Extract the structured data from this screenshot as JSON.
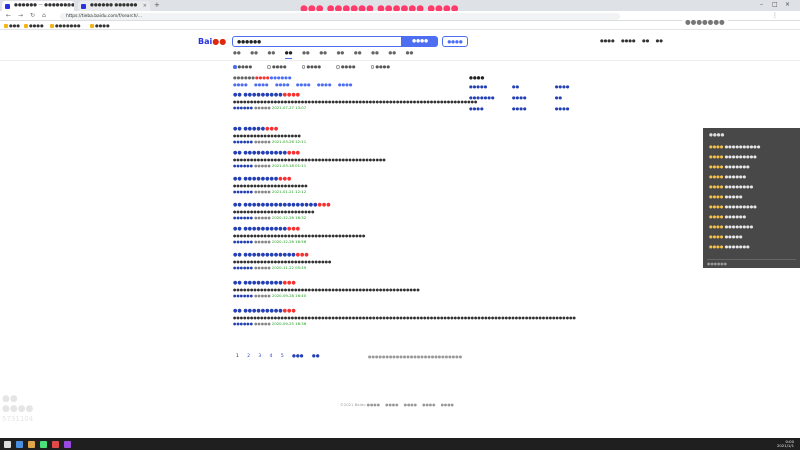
{
  "browser": {
    "tabs": [
      {
        "title": "●●●●●● — ●●●●●●●●●"
      },
      {
        "title": "●●●●●● ●●●●●●"
      }
    ],
    "new_tab": "+",
    "url": "https://tieba.baidu.com/f/search/...",
    "bookmarks": [
      "●●●",
      "●●●●",
      "●●●●●●●",
      "●●●●"
    ],
    "win_controls": [
      "–",
      "□",
      "×"
    ]
  },
  "stream_overlay": {
    "banner": "●●● ●●●●●● ●●●●●● ●●●●",
    "corner": "●●●●●●●"
  },
  "search": {
    "logo_left": "Bai",
    "logo_right": "●●",
    "query": "●●●●●●",
    "button": "●●●●",
    "button2": "●●●●",
    "top_links": [
      "●●●●",
      "●●●●",
      "●●",
      "●●"
    ]
  },
  "tabs": [
    "●●",
    "●●",
    "●●",
    "●●",
    "●●",
    "●●",
    "●●",
    "●●",
    "●●",
    "●●",
    "●●"
  ],
  "filters": [
    "●●●●",
    "●●●●",
    "●●●●",
    "●●●●",
    "●●●●"
  ],
  "tip": {
    "a": "●●●●●●",
    "b": "●●●●",
    "c": "●●●●●●"
  },
  "top_queries": [
    "●●●●",
    "●●●●",
    "●●●●",
    "●●●●",
    "●●●●",
    "●●●●"
  ],
  "results": [
    {
      "title_a": "●● ●●●●●●●●●",
      "title_b": "●●●●",
      "snippet": "●●●●●●●●●●●●●●●●●●●●●●●●●●●●●●●●●●●●●●●●●●●●●●●●●●●●●●●●●●●●●●●●●●●●●●●●",
      "meta_a": "●●●●●●",
      "meta_b": "●●●●●",
      "meta_t": "2021-07-27 13:07"
    },
    {
      "title_a": "●● ●●●●●",
      "title_b": "●●●",
      "snippet": "●●●●●●●●●●●●●●●●●●●●",
      "meta_a": "●●●●●●",
      "meta_b": "●●●●●",
      "meta_t": "2021-03-26 12:11"
    },
    {
      "title_a": "●● ●●●●●●●●●●",
      "title_b": "●●●",
      "snippet": "●●●●●●●●●●●●●●●●●●●●●●●●●●●●●●●●●●●●●●●●●●●●●",
      "meta_a": "●●●●●●",
      "meta_b": "●●●●●",
      "meta_t": "2021-03-18 01:11"
    },
    {
      "title_a": "●● ●●●●●●●●",
      "title_b": "●●●",
      "snippet": "●●●●●●●●●●●●●●●●●●●●●●",
      "meta_a": "●●●●●●",
      "meta_b": "●●●●●",
      "meta_t": "2021-01-21 12:12"
    },
    {
      "title_a": "●● ●●●●●●●●●●●●●●●●●",
      "title_b": "●●●",
      "snippet": "●●●●●●●●●●●●●●●●●●●●●●●●",
      "meta_a": "●●●●●●",
      "meta_b": "●●●●●",
      "meta_t": "2020-12-26 16:32"
    },
    {
      "title_a": "●● ●●●●●●●●●●",
      "title_b": "●●●",
      "snippet": "●●●●●●●●●●●●●●●●●●●●●●●●●●●●●●●●●●●●●●●",
      "meta_a": "●●●●●●",
      "meta_b": "●●●●●",
      "meta_t": "2020-12-26 16:56"
    },
    {
      "title_a": "●● ●●●●●●●●●●●●",
      "title_b": "●●●",
      "snippet": "●●●●●●●●●●●●●●●●●●●●●●●●●●●●●",
      "meta_a": "●●●●●●",
      "meta_b": "●●●●●",
      "meta_t": "2020-11-22 05:49"
    },
    {
      "title_a": "●● ●●●●●●●●●",
      "title_b": "●●●",
      "snippet": "●●●●●●●●●●●●●●●●●●●●●●●●●●●●●●●●●●●●●●●●●●●●●●●●●●●●●●●",
      "meta_a": "●●●●●●",
      "meta_b": "●●●●●",
      "meta_t": "2020-09-28 16:40"
    },
    {
      "title_a": "●● ●●●●●●●●●",
      "title_b": "●●●",
      "snippet": "●●●●●●●●●●●●●●●●●●●●●●●●●●●●●●●●●●●●●●●●●●●●●●●●●●●●●●●●●●●●●●●●●●●●●●●●●●●●●●●●●●●●●●●●●●●●●●●●●●●●●",
      "meta_a": "●●●●●●",
      "meta_b": "●●●●●",
      "meta_t": "2020-09-25 18:36"
    }
  ],
  "pager": {
    "pages": [
      "1",
      "2",
      "3",
      "4",
      "5"
    ],
    "next": "●●●",
    "last": "●●",
    "note": "●●●●●●●●●●●●●●●●●●●●●●●●●●●"
  },
  "footer": [
    "©2021 Baidu ●●●●",
    "●●●●",
    "●●●●",
    "●●●●",
    "●●●●"
  ],
  "related": {
    "title": "●●●●",
    "items": [
      "●●●●●",
      "●●",
      "●●●●",
      "●●●●●●●",
      "●●●●",
      "●●",
      "●●●●",
      "●●●●",
      "●●●●"
    ]
  },
  "chat": {
    "header": "●●●●",
    "lines": [
      {
        "u": "●●●●",
        "m": "●●●●●●●●●●"
      },
      {
        "u": "●●●●",
        "m": "●●●●●●●●●"
      },
      {
        "u": "●●●●",
        "m": "●●●●●●●"
      },
      {
        "u": "●●●●",
        "m": "●●●●●●"
      },
      {
        "u": "●●●●",
        "m": "●●●●●●●●"
      },
      {
        "u": "●●●●",
        "m": "●●●●●"
      },
      {
        "u": "●●●●",
        "m": "●●●●●●●●●"
      },
      {
        "u": "●●●●",
        "m": "●●●●●●"
      },
      {
        "u": "●●●●",
        "m": "●●●●●●●●"
      },
      {
        "u": "●●●●",
        "m": "●●●●●"
      },
      {
        "u": "●●●●",
        "m": "●●●●●●●"
      }
    ],
    "input": "●●●●●●"
  },
  "watermark": {
    "top": "●●",
    "mid": "●●●●",
    "id": "5731104"
  },
  "taskbar": {
    "time": "0:00",
    "date": "2021/1/1"
  },
  "colors": {
    "accent": "#4e6ef2",
    "link": "#2440b3",
    "highlight": "#f73131",
    "url_green": "#159b16"
  }
}
